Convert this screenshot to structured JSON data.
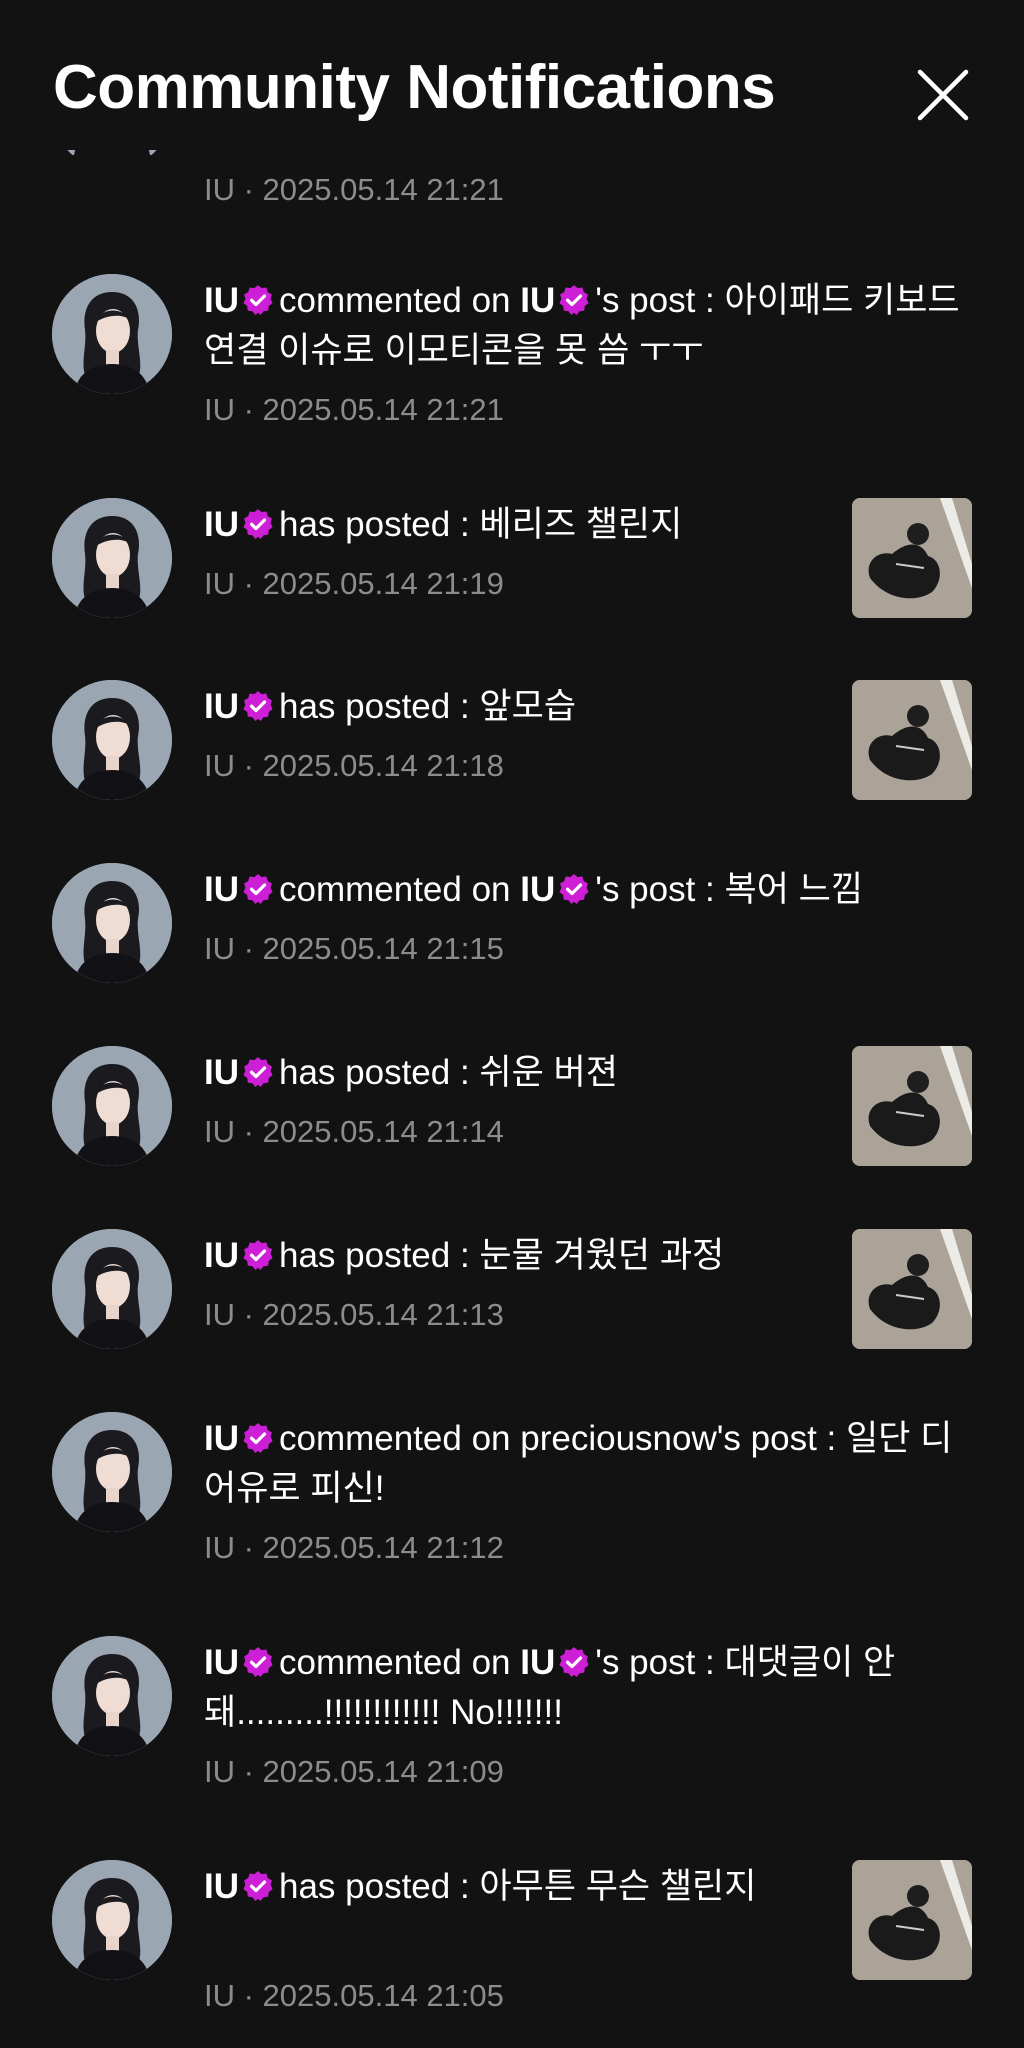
{
  "header": {
    "title": "Community Notifications"
  },
  "icons": {
    "close": "close-icon",
    "verified": "verified-badge-icon"
  },
  "colors": {
    "background": "#121212",
    "verified_badge": "#cc1fd6",
    "secondary_text": "#8c8c8c"
  },
  "partial_item": {
    "meta": "IU · 2025.05.14 21:21"
  },
  "notifications": [
    {
      "author": "IU",
      "action": "commented on",
      "target": "IU",
      "suffix": "'s post : 아이패드 키보드 연결 이슈로 이모티콘을 못 씀 ㅜㅜ",
      "meta": "IU · 2025.05.14 21:21"
    },
    {
      "author": "IU",
      "action": "has posted : 베리즈 챌린지",
      "meta": "IU · 2025.05.14 21:19"
    },
    {
      "author": "IU",
      "action": "has posted : 앞모습",
      "meta": "IU · 2025.05.14 21:18"
    },
    {
      "author": "IU",
      "action": "commented on",
      "target": "IU",
      "suffix": "'s post : 복어 느낌",
      "meta": "IU · 2025.05.14 21:15"
    },
    {
      "author": "IU",
      "action": "has posted : 쉬운 버젼",
      "meta": "IU · 2025.05.14 21:14"
    },
    {
      "author": "IU",
      "action": "has posted : 눈물 겨웠던 과정",
      "meta": "IU · 2025.05.14 21:13"
    },
    {
      "author": "IU",
      "action": "commented on preciousnow's post : 일단 디어유로 피신!",
      "meta": "IU · 2025.05.14 21:12"
    },
    {
      "author": "IU",
      "action": "commented on",
      "target": "IU",
      "suffix": "'s post : 대댓글이 안돼.........!!!!!!!!!!!! No!!!!!!!",
      "meta": "IU · 2025.05.14 21:09"
    },
    {
      "author": "IU",
      "action": "has posted : 아무튼 무슨 챌린지",
      "meta": "IU · 2025.05.14 21:05"
    }
  ]
}
